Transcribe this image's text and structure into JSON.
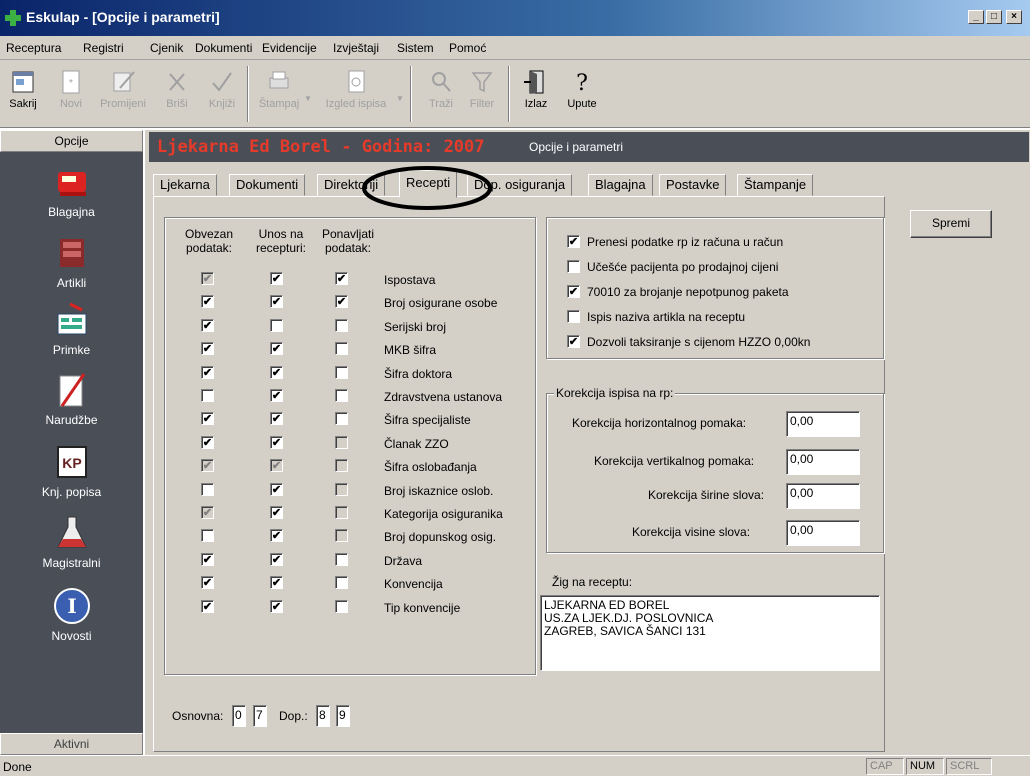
{
  "window": {
    "title": "Eskulap - [Opcije i parametri]",
    "min": "_",
    "max": "□",
    "close": "×"
  },
  "menu": [
    "Receptura",
    "Registri",
    "Cjenik",
    "Dokumenti",
    "Evidencije",
    "Izvještaji",
    "Sistem",
    "Pomoć"
  ],
  "toolbar": {
    "sakrij": "Sakrij",
    "novi": "Novi",
    "promijeni": "Promijeni",
    "brisi": "Briši",
    "knjizi": "Knjiži",
    "stampaj": "Štampaj",
    "izgled": "Izgled ispisa",
    "trazi": "Traži",
    "filter": "Filter",
    "izlaz": "Izlaz",
    "upute": "Upute"
  },
  "sidebar": {
    "header": "Opcije",
    "footer": "Aktivni",
    "items": [
      "Blagajna",
      "Artikli",
      "Primke",
      "Narudžbe",
      "Knj. popisa",
      "Magistralni",
      "Novosti"
    ]
  },
  "header": {
    "company": "Ljekarna Ed Borel - Godina: 2007",
    "subtitle": "Opcije i parametri"
  },
  "tabs": [
    "Ljekarna",
    "Dokumenti",
    "Direktoriji",
    "Recepti",
    "Dop. osiguranja",
    "Blagajna",
    "Postavke",
    "Štampanje"
  ],
  "active_tab": "Recepti",
  "recepti": {
    "col1": "Obvezan podatak:",
    "col2": "Unos na recepturi:",
    "col3": "Ponavljati podatak:",
    "rows": [
      {
        "label": "Ispostava",
        "c1": "dis-chk",
        "c2": "chk",
        "c3": "chk"
      },
      {
        "label": "Broj osigurane osobe",
        "c1": "chk",
        "c2": "chk",
        "c3": "chk"
      },
      {
        "label": "Serijski broj",
        "c1": "chk",
        "c2": "off",
        "c3": "off"
      },
      {
        "label": "MKB šifra",
        "c1": "chk",
        "c2": "chk",
        "c3": "off"
      },
      {
        "label": "Šifra doktora",
        "c1": "chk",
        "c2": "chk",
        "c3": "off"
      },
      {
        "label": "Zdravstvena ustanova",
        "c1": "off",
        "c2": "chk",
        "c3": "off"
      },
      {
        "label": "Šifra specijaliste",
        "c1": "chk",
        "c2": "chk",
        "c3": "off"
      },
      {
        "label": "Članak ZZO",
        "c1": "chk",
        "c2": "chk",
        "c3": "dis"
      },
      {
        "label": "Šifra oslobađanja",
        "c1": "dis-chk",
        "c2": "dis-chk",
        "c3": "dis"
      },
      {
        "label": "Broj iskaznice oslob.",
        "c1": "off",
        "c2": "chk",
        "c3": "dis"
      },
      {
        "label": "Kategorija osiguranika",
        "c1": "dis-chk",
        "c2": "chk",
        "c3": "dis"
      },
      {
        "label": "Broj dopunskog osig.",
        "c1": "off",
        "c2": "chk",
        "c3": "dis"
      },
      {
        "label": "Država",
        "c1": "chk",
        "c2": "chk",
        "c3": "off"
      },
      {
        "label": "Konvencija",
        "c1": "chk",
        "c2": "chk",
        "c3": "off"
      },
      {
        "label": "Tip konvencije",
        "c1": "chk",
        "c2": "chk",
        "c3": "off"
      }
    ],
    "osnovna_label": "Osnovna:",
    "osnovna": [
      "0",
      "7"
    ],
    "dop_label": "Dop.:",
    "dop": [
      "8",
      "9"
    ],
    "options": [
      {
        "label": "Prenesi podatke rp iz računa u račun",
        "checked": true
      },
      {
        "label": "Učešće pacijenta po prodajnoj cijeni",
        "checked": false
      },
      {
        "label": "70010 za brojanje nepotpunog paketa",
        "checked": true
      },
      {
        "label": "Ispis naziva artikla na receptu",
        "checked": false
      },
      {
        "label": "Dozvoli taksiranje s cijenom HZZO 0,00kn",
        "checked": true
      }
    ],
    "korekcija": {
      "legend": "Korekcija ispisa na rp:",
      "h_label": "Korekcija horizontalnog pomaka:",
      "h": "0,00",
      "v_label": "Korekcija vertikalnog pomaka:",
      "v": "0,00",
      "s_label": "Korekcija širine slova:",
      "s": "0,00",
      "vs_label": "Korekcija visine slova:",
      "vs": "0,00"
    },
    "zig_label": "Žig na receptu:",
    "zig": [
      "LJEKARNA ED BOREL",
      "US.ZA LJEK.DJ. POSLOVNICA",
      "ZAGREB, SAVICA ŠANCI 131"
    ]
  },
  "save_button": "Spremi",
  "status": {
    "text": "Done",
    "cap": "CAP",
    "num": "NUM",
    "scrl": "SCRL"
  },
  "colors": {
    "header_text": "#e63a2a",
    "sidebar_bg": "#4a4e57",
    "title_bg": "#0a246a"
  }
}
